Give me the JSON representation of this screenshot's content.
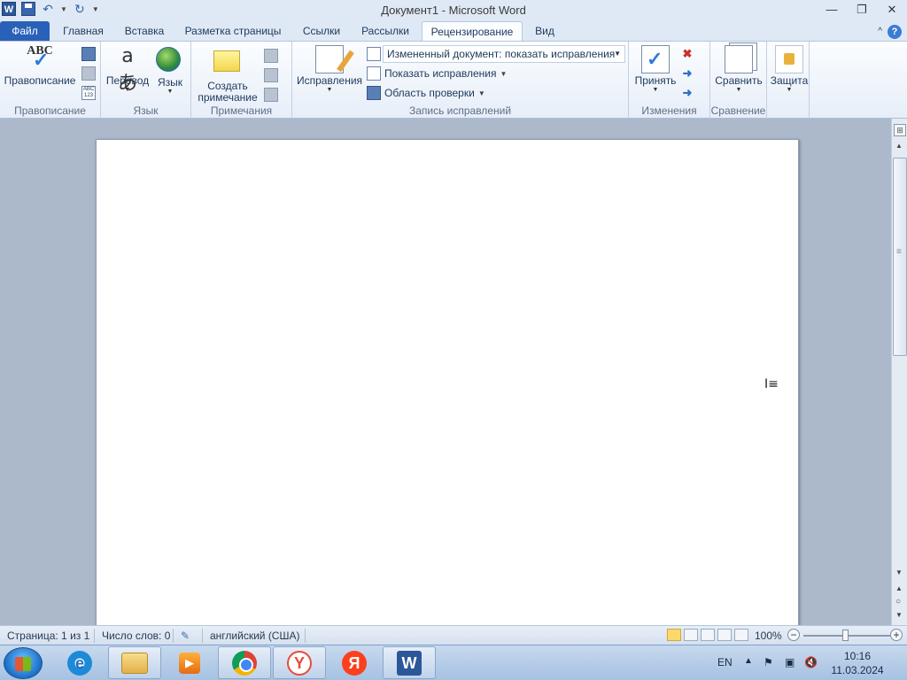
{
  "window": {
    "title": "Документ1  -  Microsoft Word",
    "qat_word_logo": "W",
    "controls": {
      "minimize": "—",
      "restore": "❐",
      "close": "✕"
    }
  },
  "tabs": {
    "file": "Файл",
    "items": [
      "Главная",
      "Вставка",
      "Разметка страницы",
      "Ссылки",
      "Рассылки",
      "Рецензирование",
      "Вид"
    ],
    "active": "Рецензирование"
  },
  "ribbon": {
    "spelling": {
      "button": "Правописание",
      "group_label": "Правописание",
      "abc_text": "ABC",
      "small_abc": "ABC\n123"
    },
    "language": {
      "translate": "Перевод",
      "language": "Язык",
      "group_label": "Язык",
      "translate_glyph": "aあ"
    },
    "comments": {
      "create_line1": "Создать",
      "create_line2": "примечание",
      "group_label": "Примечания"
    },
    "tracking": {
      "revisions_button": "Исправления",
      "display_dropdown": "Измененный документ: показать исправления",
      "show_markup": "Показать исправления",
      "reviewing_pane": "Область проверки",
      "group_label": "Запись исправлений"
    },
    "changes": {
      "accept": "Принять",
      "group_label": "Изменения"
    },
    "compare": {
      "compare": "Сравнить",
      "group_label": "Сравнение"
    },
    "protect": {
      "protect": "Защита"
    }
  },
  "statusbar": {
    "page": "Страница: 1 из 1",
    "words": "Число слов: 0",
    "language": "английский (США)",
    "zoom": "100%",
    "zoom_out": "−",
    "zoom_in": "+"
  },
  "taskbar": {
    "lang": "EN",
    "time": "10:16",
    "date": "11.03.2024",
    "apps": [
      "internet-explorer",
      "file-explorer",
      "media-player",
      "chrome",
      "yandex-browser",
      "yandex",
      "word"
    ],
    "ie_glyph": "e",
    "ybrowser_glyph": "Y",
    "yandex_glyph": "Я",
    "word_glyph": "W"
  },
  "document": {
    "cursor_glyph": "I≡"
  }
}
